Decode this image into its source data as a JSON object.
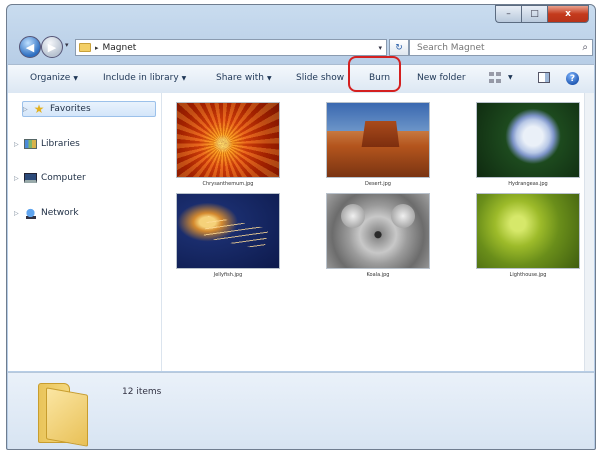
{
  "window": {
    "caption": {
      "minimize": "–",
      "maximize": "□",
      "close": "x"
    }
  },
  "address": {
    "back_glyph": "◀",
    "forward_glyph": "▶",
    "separator": "▸",
    "folder_name": "Magnet",
    "dropdown_glyph": "▾",
    "refresh_glyph": "↻",
    "search_placeholder": "Search Magnet",
    "search_icon_glyph": "⌕"
  },
  "toolbar": {
    "organize": "Organize",
    "include_in_library": "Include in library",
    "share_with": "Share with",
    "slide_show": "Slide show",
    "burn": "Burn",
    "new_folder": "New folder",
    "help_glyph": "?",
    "arrow_glyph": "▼"
  },
  "nav": {
    "favorites": "Favorites",
    "libraries": "Libraries",
    "computer": "Computer",
    "network": "Network",
    "expand_glyph": "▷"
  },
  "files": [
    {
      "name": "Chrysanthemum.jpg",
      "image": "chrysanthemum"
    },
    {
      "name": "Desert.jpg",
      "image": "desert"
    },
    {
      "name": "Hydrangeas.jpg",
      "image": "hydrangea"
    },
    {
      "name": "Jellyfish.jpg",
      "image": "jellyfish"
    },
    {
      "name": "Koala.jpg",
      "image": "koala"
    },
    {
      "name": "Lighthouse.jpg",
      "image": "lighthouse"
    }
  ],
  "details": {
    "item_count": "12 items"
  },
  "colors": {
    "highlight_ring": "#d42020",
    "selection": "#d4e6fa"
  }
}
